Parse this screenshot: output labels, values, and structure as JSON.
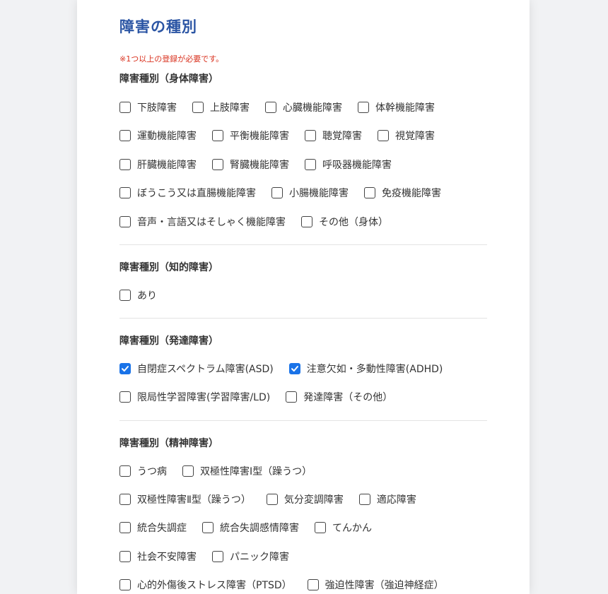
{
  "title": "障害の種別",
  "note": "※1つ以上の登録が必要です。",
  "sections": [
    {
      "title": "障害種別（身体障害）",
      "rows": [
        [
          {
            "label": "下肢障害",
            "checked": false
          },
          {
            "label": "上肢障害",
            "checked": false
          },
          {
            "label": "心臓機能障害",
            "checked": false
          },
          {
            "label": "体幹機能障害",
            "checked": false
          }
        ],
        [
          {
            "label": "運動機能障害",
            "checked": false
          },
          {
            "label": "平衡機能障害",
            "checked": false
          },
          {
            "label": "聴覚障害",
            "checked": false
          },
          {
            "label": "視覚障害",
            "checked": false
          }
        ],
        [
          {
            "label": "肝臓機能障害",
            "checked": false
          },
          {
            "label": "腎臓機能障害",
            "checked": false
          },
          {
            "label": "呼吸器機能障害",
            "checked": false
          }
        ],
        [
          {
            "label": "ぼうこう又は直腸機能障害",
            "checked": false
          },
          {
            "label": "小腸機能障害",
            "checked": false
          },
          {
            "label": "免疫機能障害",
            "checked": false
          }
        ],
        [
          {
            "label": "音声・言語又はそしゃく機能障害",
            "checked": false
          },
          {
            "label": "その他（身体）",
            "checked": false
          }
        ]
      ]
    },
    {
      "title": "障害種別（知的障害）",
      "rows": [
        [
          {
            "label": "あり",
            "checked": false
          }
        ]
      ]
    },
    {
      "title": "障害種別（発達障害）",
      "rows": [
        [
          {
            "label": "自閉症スペクトラム障害(ASD)",
            "checked": true
          },
          {
            "label": "注意欠如・多動性障害(ADHD)",
            "checked": true
          }
        ],
        [
          {
            "label": "限局性学習障害(学習障害/LD)",
            "checked": false
          },
          {
            "label": "発達障害（その他）",
            "checked": false
          }
        ]
      ]
    },
    {
      "title": "障害種別（精神障害）",
      "rows": [
        [
          {
            "label": "うつ病",
            "checked": false
          },
          {
            "label": "双極性障害Ⅰ型（躁うつ）",
            "checked": false
          }
        ],
        [
          {
            "label": "双極性障害Ⅱ型（躁うつ）",
            "checked": false
          },
          {
            "label": "気分変調障害",
            "checked": false
          },
          {
            "label": "適応障害",
            "checked": false
          }
        ],
        [
          {
            "label": "統合失調症",
            "checked": false
          },
          {
            "label": "統合失調感情障害",
            "checked": false
          },
          {
            "label": "てんかん",
            "checked": false
          }
        ],
        [
          {
            "label": "社会不安障害",
            "checked": false
          },
          {
            "label": "パニック障害",
            "checked": false
          }
        ],
        [
          {
            "label": "心的外傷後ストレス障害（PTSD）",
            "checked": false
          },
          {
            "label": "強迫性障害（強迫神経症）",
            "checked": false
          }
        ]
      ]
    }
  ],
  "colors": {
    "title": "#2b55a4",
    "note": "#d9321f",
    "checked": "#1a73e8"
  }
}
